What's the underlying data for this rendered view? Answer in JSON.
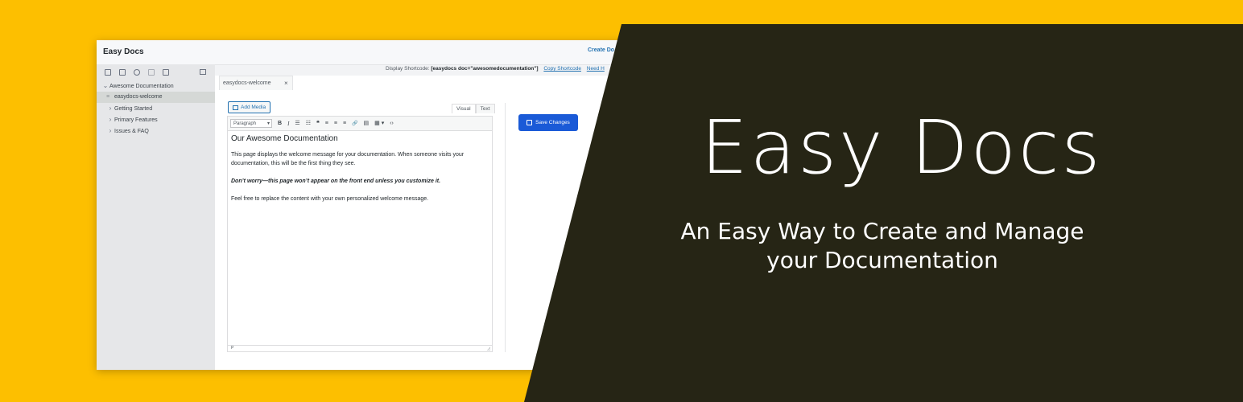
{
  "colors": {
    "background_yellow": "#fdbf00",
    "dark_panel": "#262515",
    "accent_blue": "#1a5ad7",
    "link_blue": "#2271b1"
  },
  "app": {
    "title": "Easy Docs",
    "create_doc_link": "Create Do"
  },
  "sidebar": {
    "tools": [
      "folder-add-icon",
      "file-add-icon",
      "link-icon",
      "duplicate-icon",
      "trash-icon"
    ],
    "collapse_icon": "collapse-icon",
    "tree": {
      "root_label": "Awesome Documentation",
      "selected_label": "easydocs-welcome",
      "items": [
        "Getting Started",
        "Primary Features",
        "Issues & FAQ"
      ]
    }
  },
  "shortcode_bar": {
    "label": "Display Shortcode:",
    "shortcode": "[easydocs doc=\"awesomedocumentation\"]",
    "copy_link": "Copy Shortcode",
    "help_link": "Need H"
  },
  "editor": {
    "tab_label": "easydocs-welcome",
    "tab_close": "×",
    "add_media": "Add Media",
    "mode_visual": "Visual",
    "mode_text": "Text",
    "format_select": "Paragraph",
    "toolbar_buttons": [
      "B",
      "I",
      "☰",
      "☷",
      "❝",
      "≡",
      "≡",
      "≡",
      "🔗",
      "▤",
      "▦ ▾",
      "‹›"
    ],
    "heading": "Our Awesome Documentation",
    "paragraph1": "This page displays the welcome message for your documentation. When someone visits your documentation, this will be the first thing they see.",
    "paragraph2": "Don’t worry—this page won’t appear on the front end unless you customize it.",
    "paragraph3": "Feel free to replace the content with your own personalized welcome message.",
    "status_path": "P",
    "resize_glyph": "◿"
  },
  "save_button": "Save Changes",
  "hero": {
    "title": "Easy Docs",
    "subtitle_line1": "An Easy Way to Create and Manage",
    "subtitle_line2": "your Documentation"
  }
}
